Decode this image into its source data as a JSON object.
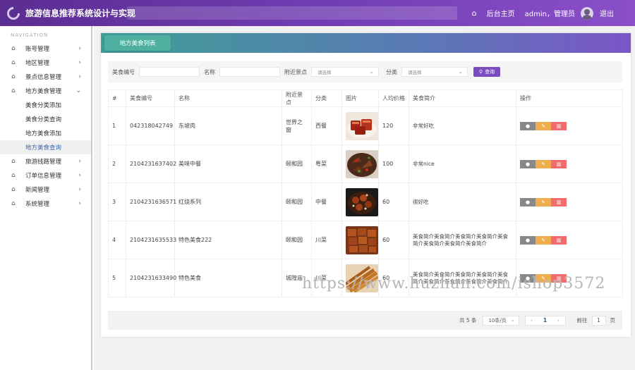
{
  "header": {
    "title": "旅游信息推荐系统设计与实现",
    "home_label": "后台主页",
    "user_label": "admin，管理员",
    "logout_label": "退出"
  },
  "sidebar": {
    "heading": "NAVIGATION",
    "items": [
      {
        "label": "账号管理"
      },
      {
        "label": "地区管理"
      },
      {
        "label": "景点信息管理"
      },
      {
        "label": "地方美食管理"
      },
      {
        "label": "旅游线路管理"
      },
      {
        "label": "订单信息管理"
      },
      {
        "label": "新闻管理"
      },
      {
        "label": "系统管理"
      }
    ],
    "subitems": [
      {
        "label": "美食分类添加"
      },
      {
        "label": "美食分类查询"
      },
      {
        "label": "地方美食添加"
      },
      {
        "label": "地方美食查询"
      }
    ]
  },
  "main": {
    "tab_label": "地方美食列表",
    "search": {
      "code_label": "美食编号",
      "name_label": "名称",
      "spot_label": "附近景点",
      "spot_placeholder": "请选择",
      "category_label": "分类",
      "category_placeholder": "请选择",
      "button_label": "查询"
    },
    "table": {
      "headers": [
        "#",
        "美食编号",
        "名称",
        "附近景点",
        "分类",
        "图片",
        "人均价格",
        "美食简介",
        "操作"
      ],
      "rows": [
        {
          "idx": "1",
          "code": "042318042749",
          "name": "东坡肉",
          "spot": "世界之窗",
          "cat": "西餐",
          "price": "120",
          "desc": "非常好吃",
          "img": "dongpo"
        },
        {
          "idx": "2",
          "code": "2104231637402",
          "name": "美味中餐",
          "spot": "颐和园",
          "cat": "粤菜",
          "price": "100",
          "desc": "非常nice",
          "img": "stirfry"
        },
        {
          "idx": "3",
          "code": "2104231636571",
          "name": "红烧系列",
          "spot": "颐和园",
          "cat": "中餐",
          "price": "60",
          "desc": "很好吃",
          "img": "braised"
        },
        {
          "idx": "4",
          "code": "2104231635533",
          "name": "特色美食222",
          "spot": "颐和园",
          "cat": "川菜",
          "price": "60",
          "desc": "美食简介美食简介美食简介美食简介美食简介美食简介美食简介美食简介",
          "img": "cubes"
        },
        {
          "idx": "5",
          "code": "2104231633490",
          "name": "特色美食",
          "spot": "城隍庙",
          "cat": "川菜",
          "price": "60",
          "desc": "美食简介美食简介美食简介美食简介美食简介美食简介美食简介美食简介美食简介",
          "img": "skewers"
        }
      ]
    },
    "pager": {
      "total": "共 5 条",
      "page_size": "10条/页",
      "prev": "‹",
      "current": "1",
      "next": "›",
      "goto_label": "前往",
      "goto_value": "1",
      "page_unit": "页"
    }
  },
  "watermark": "https://www.huzhan.com/ishop3572",
  "colors": {
    "header_start": "#5b2d91",
    "header_end": "#8a4fc9",
    "tab_teal": "#4fb0a2",
    "search_button": "#7a4cc0",
    "view_button": "#888888",
    "edit_button": "#f0ad4e",
    "delete_button": "#f16d6d"
  },
  "icons": {
    "menu": "home-icon",
    "chevron": "chevron-right-icon",
    "search": "search-icon",
    "view": "info-icon",
    "edit": "pencil-icon",
    "delete": "trash-icon"
  }
}
